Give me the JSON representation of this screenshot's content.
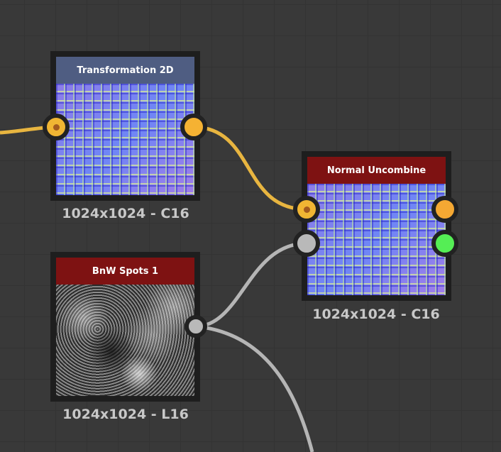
{
  "nodes": [
    {
      "title": "Transformation 2D",
      "info": "1024x1024 - C16",
      "header_color": "#4f5d82"
    },
    {
      "title": "Normal Uncombine",
      "info": "1024x1024 - C16",
      "header_color": "#7e1212"
    },
    {
      "title": "BnW Spots 1",
      "info": "1024x1024 - L16",
      "header_color": "#7e1212"
    }
  ],
  "colors": {
    "color_port": "#f5b233",
    "gray_port": "#b9b9b9",
    "green_port": "#55ee55",
    "wire_color": "#e8b540",
    "wire_gray": "#b5b5b5"
  }
}
